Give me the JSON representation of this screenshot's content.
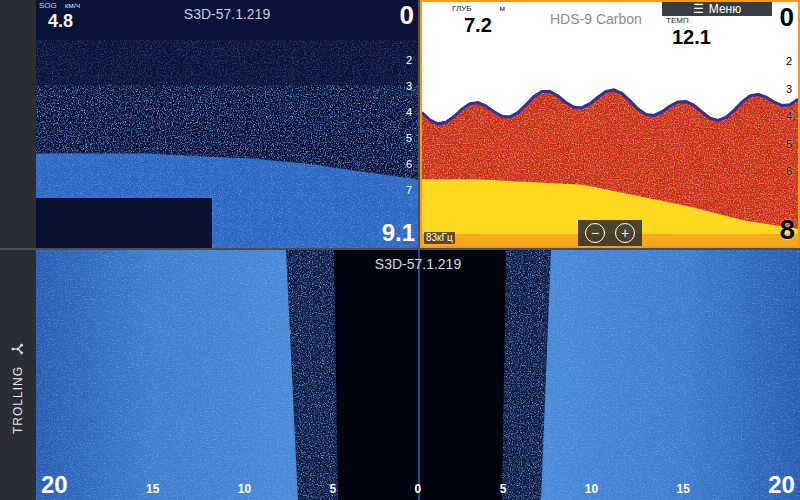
{
  "mode_bar": {
    "label": "TROLLING"
  },
  "down_scan": {
    "selected": false,
    "title": "S3D-57.1.219",
    "speed_label": "SOG",
    "speed_unit": "км/ч",
    "speed": "4.8",
    "depth_top": "0",
    "depth_ticks": [
      "2",
      "3",
      "4",
      "5",
      "6",
      "7"
    ],
    "range": "9.1",
    "bottom_depths": [
      5.6,
      5.6,
      5.6,
      5.7,
      5.8,
      6.0,
      6.3,
      6.6
    ]
  },
  "sonar": {
    "selected": true,
    "title": "HDS-9 Carbon",
    "depth_label": "ГЛУБ",
    "depth_unit": "м",
    "depth": "7.2",
    "temp_label": "ТЕМП",
    "temp": "12.1",
    "depth_top": "0",
    "depth_ticks": [
      "2",
      "3",
      "4",
      "5",
      "6"
    ],
    "range": "8",
    "frequency": "83кГц",
    "zoom_out": "−",
    "zoom_in": "+",
    "bottom_depths": [
      6.3,
      6.3,
      6.4,
      6.5,
      6.9,
      7.3,
      7.8,
      8.1
    ]
  },
  "menu": {
    "icon": "☰",
    "label": "Меню"
  },
  "side_scan": {
    "selected": false,
    "title": "S3D-57.1.219",
    "range_ticks": [
      "20",
      "15",
      "10",
      "5",
      "0",
      "5",
      "10",
      "15",
      "20"
    ]
  }
}
